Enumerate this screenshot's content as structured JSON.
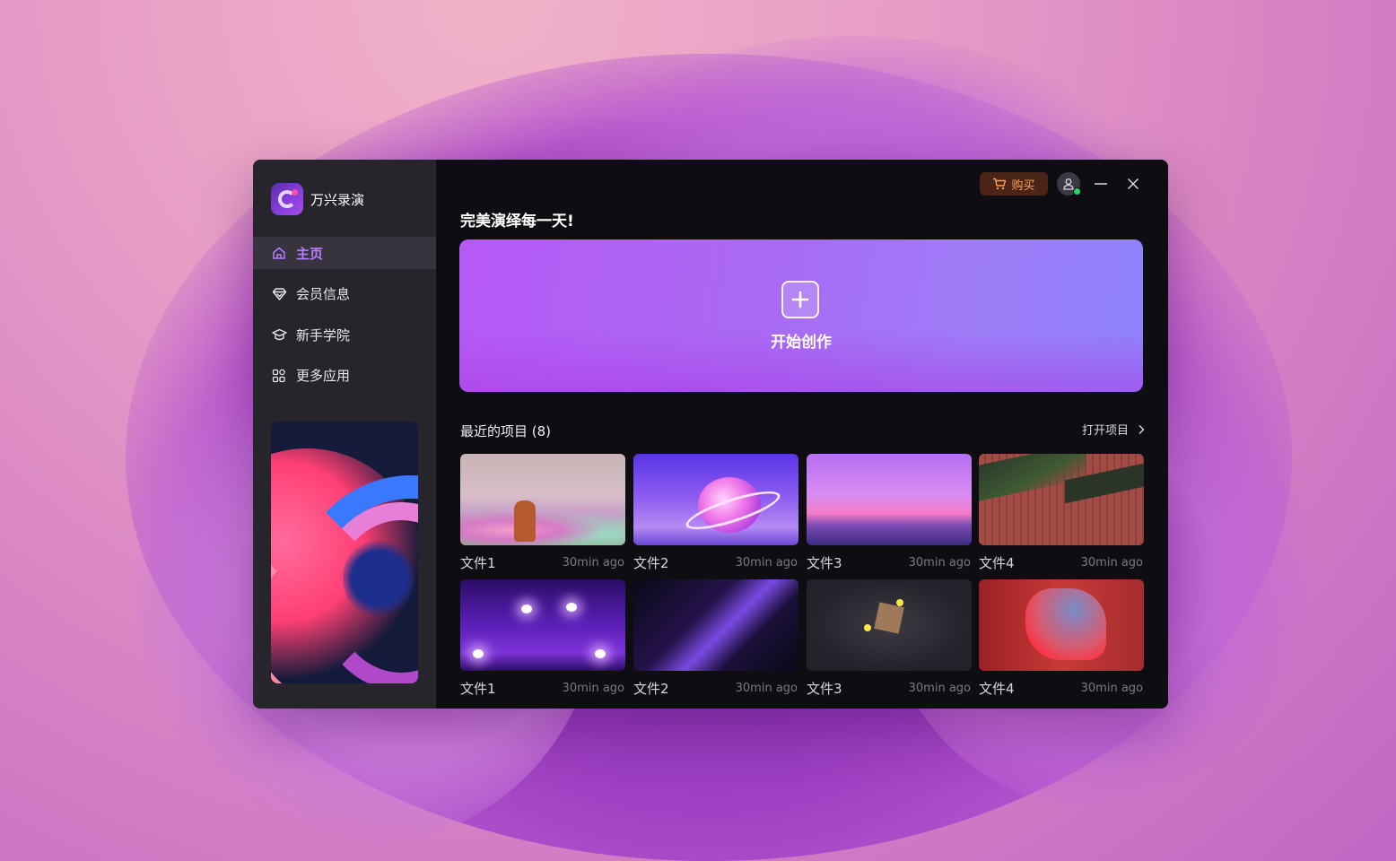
{
  "app": {
    "name": "万兴录演"
  },
  "sidebar": {
    "items": [
      {
        "label": "主页",
        "icon": "home-icon",
        "active": true
      },
      {
        "label": "会员信息",
        "icon": "diamond-icon",
        "active": false
      },
      {
        "label": "新手学院",
        "icon": "graduation-cap-icon",
        "active": false
      },
      {
        "label": "更多应用",
        "icon": "apps-grid-icon",
        "active": false
      }
    ]
  },
  "topbar": {
    "buy_label": "购买"
  },
  "main": {
    "slogan": "完美演绎每一天!",
    "hero_label": "开始创作",
    "recent_title": "最近的项目 (8)",
    "open_project": "打开项目"
  },
  "projects": [
    {
      "name": "文件1",
      "time": "30min ago"
    },
    {
      "name": "文件2",
      "time": "30min ago"
    },
    {
      "name": "文件3",
      "time": "30min ago"
    },
    {
      "name": "文件4",
      "time": "30min ago"
    },
    {
      "name": "文件1",
      "time": "30min ago"
    },
    {
      "name": "文件2",
      "time": "30min ago"
    },
    {
      "name": "文件3",
      "time": "30min ago"
    },
    {
      "name": "文件4",
      "time": "30min ago"
    }
  ],
  "colors": {
    "accent": "#b97cff",
    "buy_text": "#ff9d5c",
    "online": "#22d46a"
  }
}
